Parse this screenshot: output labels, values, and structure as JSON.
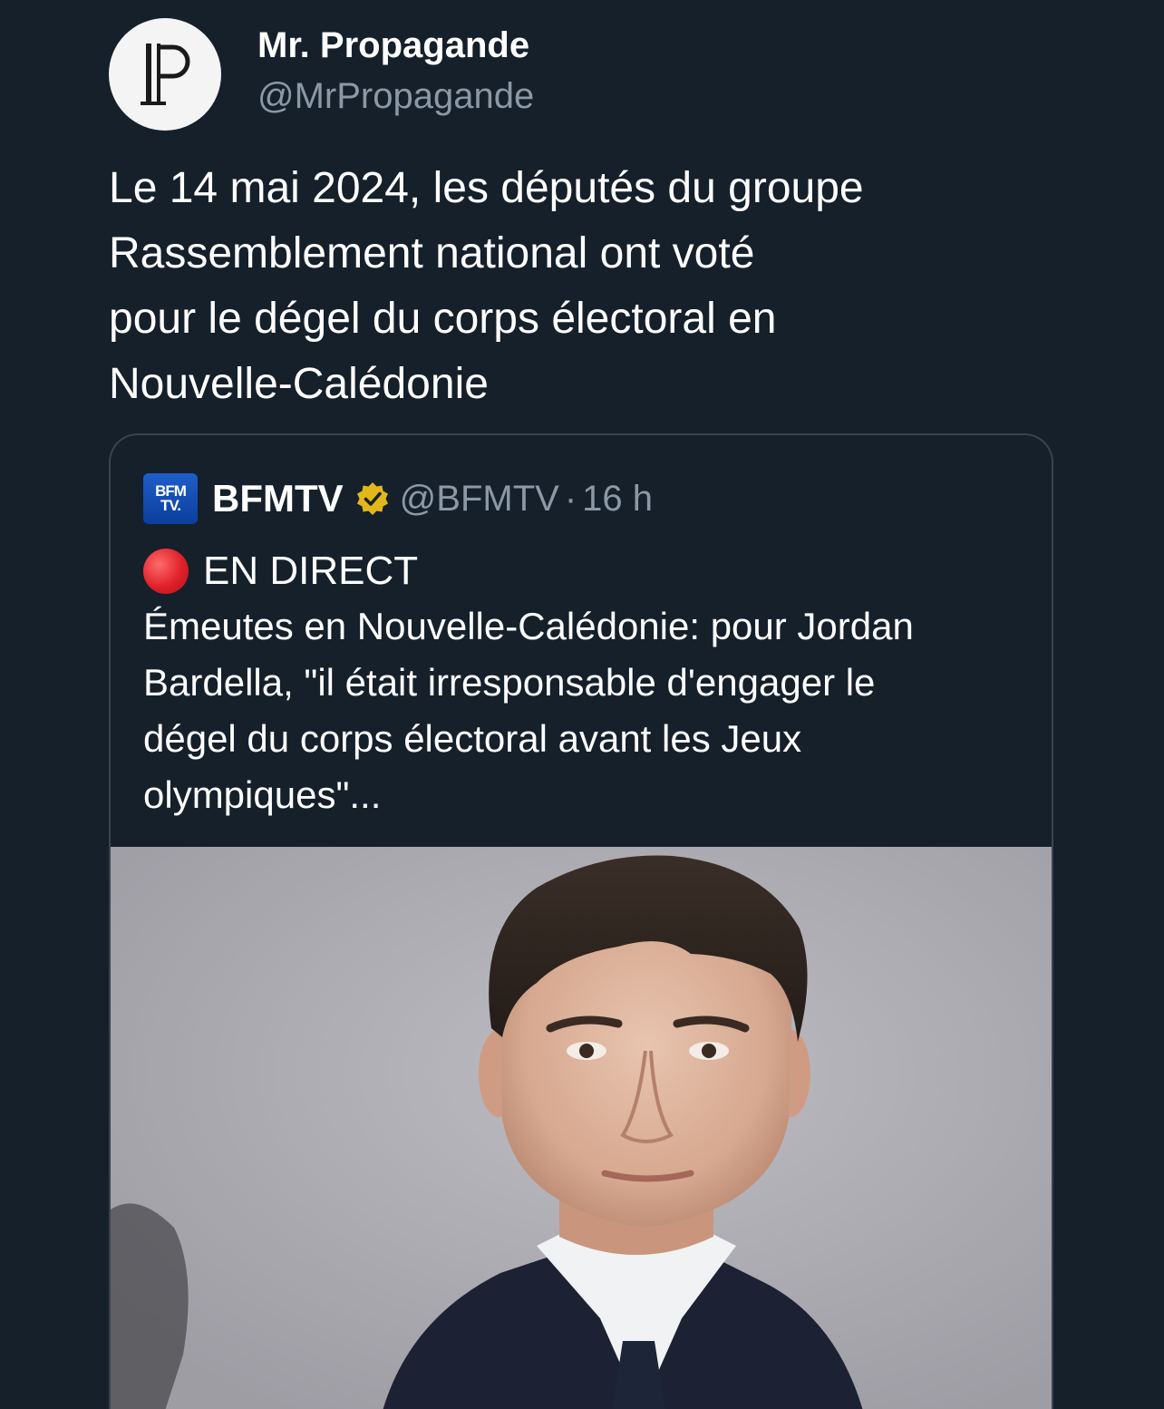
{
  "author": {
    "display_name": "Mr. Propagande",
    "handle": "@MrPropagande",
    "avatar_icon": "p-monogram-logo"
  },
  "tweet": {
    "lines": [
      "Le 14 mai 2024, les députés du groupe",
      "Rassemblement national ont voté",
      "pour le dégel du corps électoral en",
      "Nouvelle-Calédonie"
    ]
  },
  "quote": {
    "logo_text_top": "BFM",
    "logo_text_bottom": "TV.",
    "name": "BFMTV",
    "verified_icon": "gold-verified-badge-icon",
    "handle": "@BFMTV",
    "separator": "·",
    "time": "16 h",
    "live_label": "EN DIRECT",
    "body_lines": [
      "Émeutes en Nouvelle-Calédonie: pour Jordan",
      "Bardella, \"il était irresponsable d'engager le",
      "dégel du corps électoral avant les Jeux",
      "olympiques\"..."
    ],
    "image_subject": "portrait-photo"
  },
  "colors": {
    "background": "#15202b",
    "secondary_text": "#8b98a5",
    "border": "#38444d",
    "verified_gold": "#e2b719",
    "live_red": "#e0202a"
  }
}
